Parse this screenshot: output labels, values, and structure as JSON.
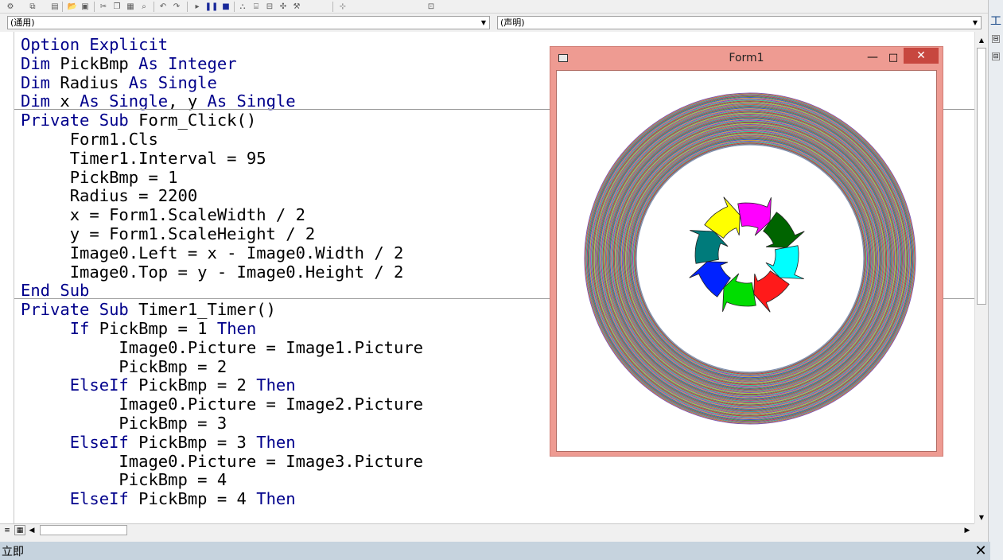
{
  "combos": {
    "object": "(通用)",
    "procedure": "(声明)"
  },
  "code_lines": [
    [
      {
        "t": "Option Explicit",
        "k": true
      }
    ],
    [
      {
        "t": "Dim",
        "k": true
      },
      {
        "t": " PickBmp "
      },
      {
        "t": "As Integer",
        "k": true
      }
    ],
    [
      {
        "t": "Dim",
        "k": true
      },
      {
        "t": " Radius "
      },
      {
        "t": "As Single",
        "k": true
      }
    ],
    [
      {
        "t": "Dim",
        "k": true
      },
      {
        "t": " x "
      },
      {
        "t": "As Single",
        "k": true
      },
      {
        "t": ", y "
      },
      {
        "t": "As Single",
        "k": true
      }
    ],
    [
      {
        "t": "Private Sub",
        "k": true
      },
      {
        "t": " Form_Click()"
      }
    ],
    [
      {
        "t": "     Form1.Cls"
      }
    ],
    [
      {
        "t": "     Timer1.Interval = 95"
      }
    ],
    [
      {
        "t": "     PickBmp = 1"
      }
    ],
    [
      {
        "t": "     Radius = 2200"
      }
    ],
    [
      {
        "t": "     x = Form1.ScaleWidth / 2"
      }
    ],
    [
      {
        "t": "     y = Form1.ScaleHeight / 2"
      }
    ],
    [
      {
        "t": "     Image0.Left = x - Image0.Width / 2"
      }
    ],
    [
      {
        "t": "     Image0.Top = y - Image0.Height / 2"
      }
    ],
    [
      {
        "t": "End Sub",
        "k": true
      }
    ],
    [
      {
        "t": "Private Sub",
        "k": true
      },
      {
        "t": " Timer1_Timer()"
      }
    ],
    [
      {
        "t": "     "
      },
      {
        "t": "If",
        "k": true
      },
      {
        "t": " PickBmp = 1 "
      },
      {
        "t": "Then",
        "k": true
      }
    ],
    [
      {
        "t": "          Image0.Picture = Image1.Picture"
      }
    ],
    [
      {
        "t": "          PickBmp = 2"
      }
    ],
    [
      {
        "t": "     "
      },
      {
        "t": "ElseIf",
        "k": true
      },
      {
        "t": " PickBmp = 2 "
      },
      {
        "t": "Then",
        "k": true
      }
    ],
    [
      {
        "t": "          Image0.Picture = Image2.Picture"
      }
    ],
    [
      {
        "t": "          PickBmp = 3"
      }
    ],
    [
      {
        "t": "     "
      },
      {
        "t": "ElseIf",
        "k": true
      },
      {
        "t": " PickBmp = 3 "
      },
      {
        "t": "Then",
        "k": true
      }
    ],
    [
      {
        "t": "          Image0.Picture = Image3.Picture"
      }
    ],
    [
      {
        "t": "          PickBmp = 4"
      }
    ],
    [
      {
        "t": "     "
      },
      {
        "t": "ElseIf",
        "k": true
      },
      {
        "t": " PickBmp = 4 "
      },
      {
        "t": "Then",
        "k": true
      }
    ]
  ],
  "form1": {
    "title": "Form1",
    "minimize_glyph": "—",
    "maximize_glyph": "□",
    "close_glyph": "✕"
  },
  "immediate": {
    "label": "立即",
    "close_glyph": "✕"
  },
  "right_strip": {
    "label": "工"
  },
  "colors": {
    "keyword": "#00008b",
    "form_frame": "#ee9b92",
    "close_button": "#c7473f",
    "immediate_bar": "#c6d3de"
  },
  "arrow_colors": [
    "#ff00ff",
    "#006400",
    "#00ffff",
    "#ff1a1a",
    "#00dd00",
    "#0022ff",
    "#007b7b",
    "#ffff00"
  ]
}
